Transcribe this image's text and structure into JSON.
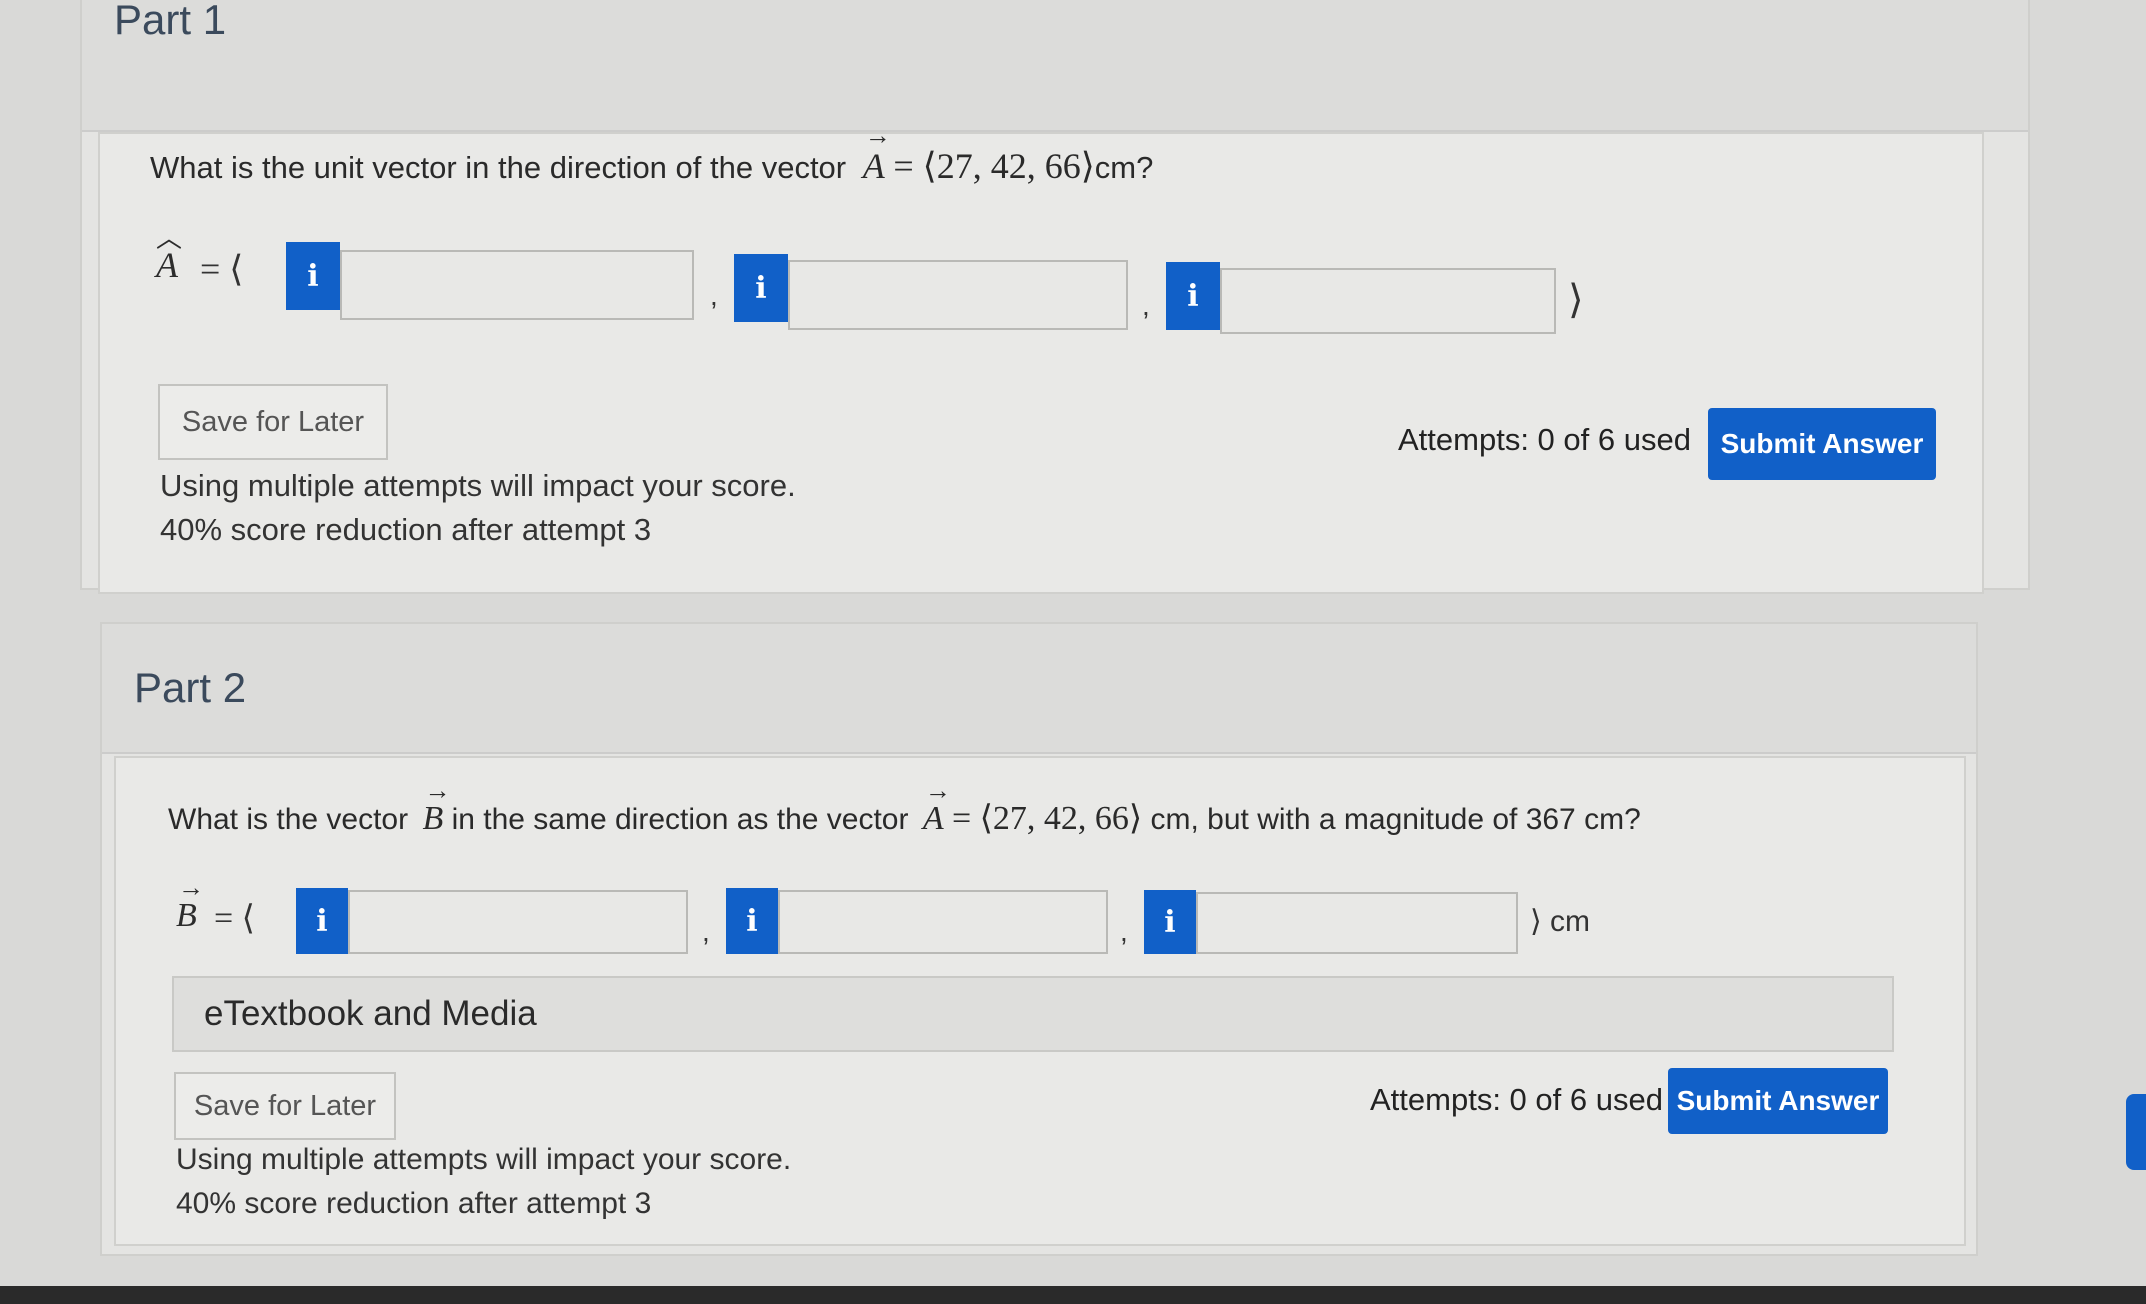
{
  "part1": {
    "title": "Part 1",
    "question_prefix": "What is the unit vector in the direction of the vector",
    "vector_symbol": "A",
    "vector_value": "= ⟨27, 42, 66⟩",
    "question_suffix": "cm?",
    "answer_label": "A",
    "equals_open": "= ⟨",
    "close_bracket": "⟩",
    "inputs": [
      "",
      "",
      ""
    ],
    "info_glyph": "i",
    "save_label": "Save for Later",
    "attempts": "Attempts: 0 of 6 used",
    "submit_label": "Submit Answer",
    "note_line1": "Using multiple attempts will impact your score.",
    "note_line2": "40% score reduction after attempt 3"
  },
  "part2": {
    "title": "Part 2",
    "question_prefix": "What is the vector",
    "vector_symbol_b": "B",
    "question_middle": "in the same direction as the vector",
    "vector_symbol_a": "A",
    "vector_value": "= ⟨27, 42, 66⟩",
    "question_suffix": "cm, but with a magnitude of 367 cm?",
    "answer_label": "B",
    "equals_open": "= ⟨",
    "close_unit": "⟩ cm",
    "inputs": [
      "",
      "",
      ""
    ],
    "info_glyph": "i",
    "etextbook_label": "eTextbook and Media",
    "save_label": "Save for Later",
    "attempts": "Attempts: 0 of 6 used",
    "submit_label": "Submit Answer",
    "note_line1": "Using multiple attempts will impact your score.",
    "note_line2": "40% score reduction after attempt 3"
  },
  "colors": {
    "accent": "#1160c8",
    "background": "#d9d9d7"
  }
}
